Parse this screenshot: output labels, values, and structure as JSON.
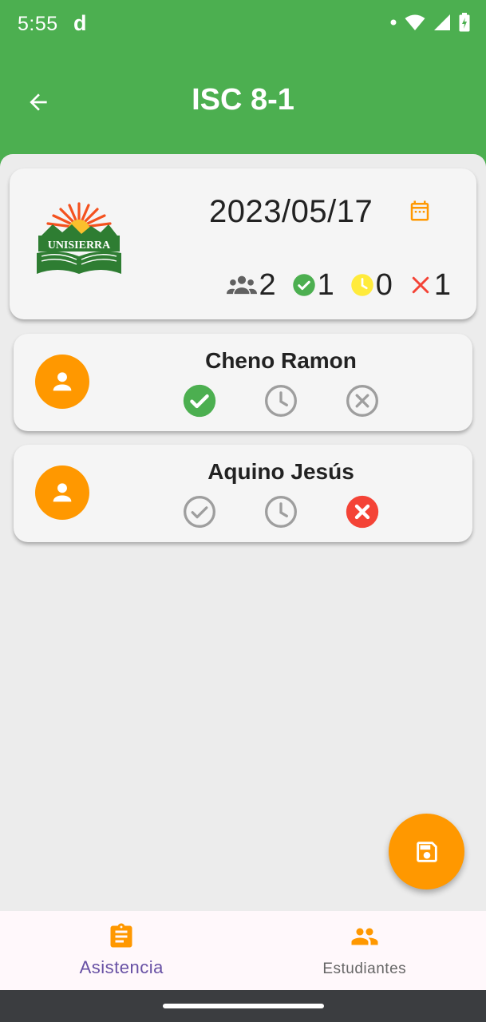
{
  "status_bar": {
    "time": "5:55",
    "notification": "d",
    "icons": [
      "dot-icon",
      "wifi-icon",
      "signal-icon",
      "battery-icon"
    ]
  },
  "app_bar": {
    "title": "ISC 8-1",
    "color": "#4caf50",
    "back_icon": "arrow-back-icon"
  },
  "summary": {
    "logo_text": "UNISIERRA",
    "date": "2023/05/17",
    "calendar_icon": "calendar-icon",
    "stats": {
      "total": "2",
      "present": "1",
      "late": "0",
      "absent": "1"
    }
  },
  "students": [
    {
      "name": "Cheno Ramon",
      "status": "present"
    },
    {
      "name": "Aquino Jesús",
      "status": "absent"
    }
  ],
  "fab": {
    "icon": "save-icon",
    "color": "#ff9800"
  },
  "bottom_nav": {
    "items": [
      {
        "label": "Asistencia",
        "icon": "clipboard-icon",
        "active": true
      },
      {
        "label": "Estudiantes",
        "icon": "people-icon",
        "active": false
      }
    ],
    "active_color": "#6750a4"
  },
  "colors": {
    "accent": "#ff9800",
    "present": "#4caf50",
    "late": "#ffeb3b",
    "absent": "#f44336",
    "inactive": "#9e9e9e"
  }
}
